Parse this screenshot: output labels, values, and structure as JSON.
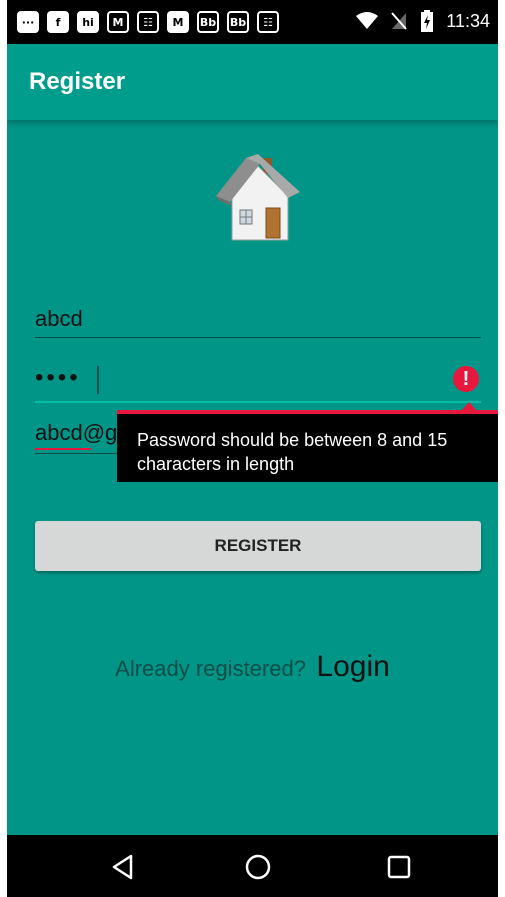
{
  "status_bar": {
    "time": "11:34",
    "notification_icons": [
      "···",
      "f",
      "hi",
      "M",
      "☷",
      "M",
      "Bb",
      "Bb",
      "☷"
    ]
  },
  "app_bar": {
    "title": "Register"
  },
  "form": {
    "username_value": "abcd",
    "password_value": "••••",
    "email_value_visible": "abcd@g"
  },
  "error": {
    "message": "Password should be between 8 and 15 characters in length"
  },
  "register_button": {
    "label": "REGISTER"
  },
  "footer": {
    "already_text": "Already registered?",
    "login_label": "Login"
  },
  "colors": {
    "background": "#009587",
    "app_bar": "#009d8c",
    "error": "#e8173d",
    "button": "#d6d7d7"
  }
}
